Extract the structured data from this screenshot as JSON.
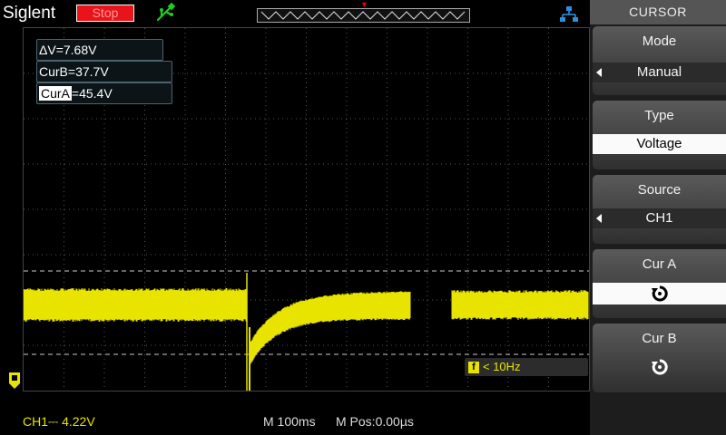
{
  "header": {
    "brand": "Siglent",
    "run_state": "Stop",
    "usb_icon": "usb-icon",
    "network_icon": "network-icon"
  },
  "readouts": {
    "delta": "ΔV=7.68V",
    "cur_b": "CurB=37.7V",
    "cur_a_label": "CurA",
    "cur_a_value": "=45.4V"
  },
  "frequency": {
    "tag": "f",
    "value": "< 10Hz"
  },
  "status": {
    "channel": "CH1",
    "coupling_symbol": "⎓",
    "channel_scale": "4.22V",
    "timebase": "M 100ms",
    "position": "M Pos:0.00µs"
  },
  "menu": {
    "title": "CURSOR",
    "mode": {
      "label": "Mode",
      "value": "Manual"
    },
    "type": {
      "label": "Type",
      "value": "Voltage"
    },
    "source": {
      "label": "Source",
      "value": "CH1"
    },
    "cur_a": {
      "label": "Cur A",
      "icon": "rotate-knob-icon"
    },
    "cur_b": {
      "label": "Cur B",
      "icon": "rotate-knob-icon"
    }
  },
  "colors": {
    "trace": "#e8e400",
    "run_state_bg": "#e8141a",
    "usb_icon": "#22c82a",
    "network_icon": "#2d8fe0"
  }
}
